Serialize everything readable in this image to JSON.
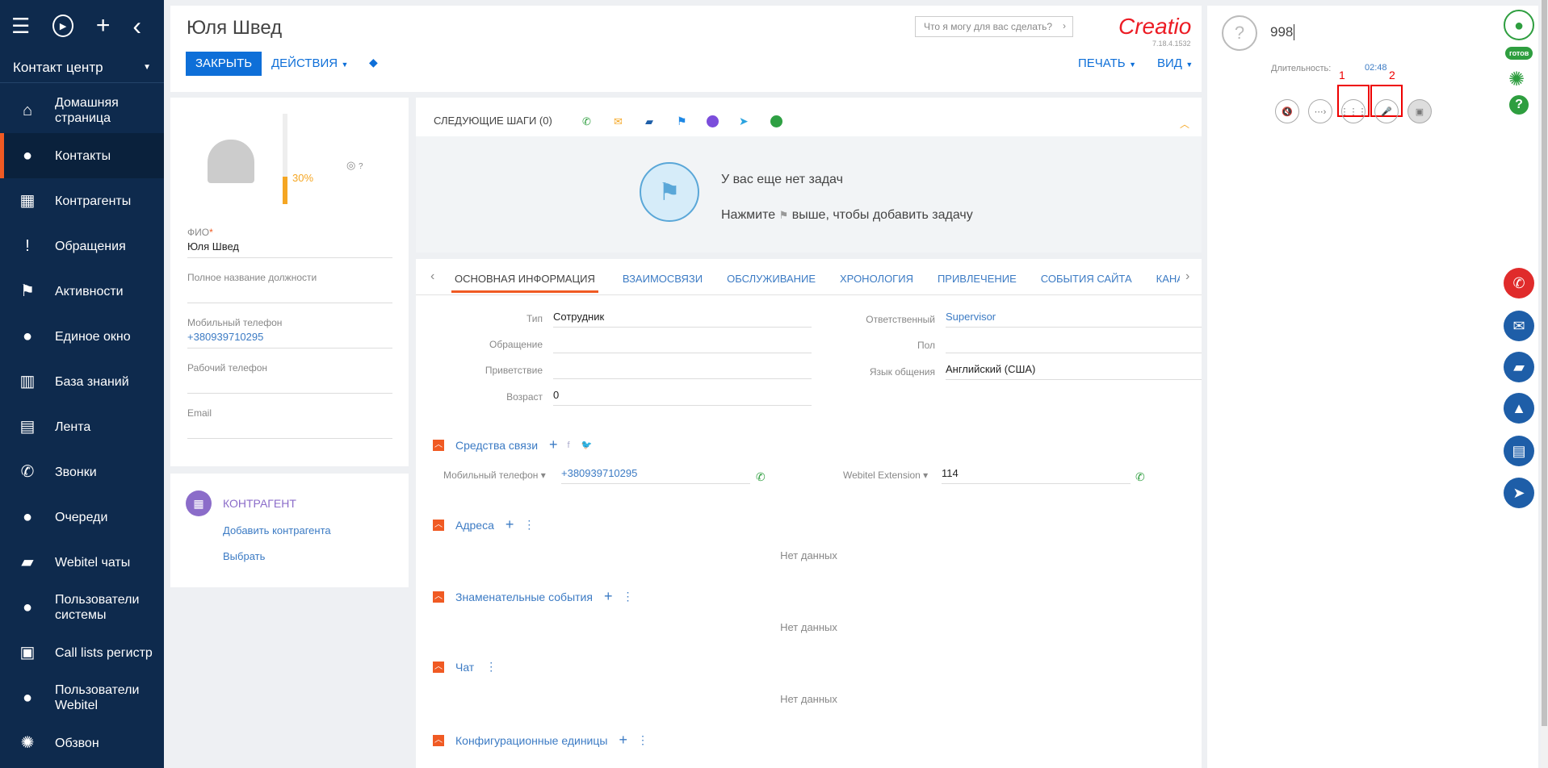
{
  "topbar": {
    "menu": "☰",
    "play": "▶",
    "add": "+",
    "back": "‹"
  },
  "workspace": "Контакт центр",
  "nav": [
    {
      "label": "Домашняя страница",
      "icon": "home-icon",
      "glyph": "⌂"
    },
    {
      "label": "Контакты",
      "icon": "person-icon",
      "glyph": "●"
    },
    {
      "label": "Контрагенты",
      "icon": "building-icon",
      "glyph": "▦"
    },
    {
      "label": "Обращения",
      "icon": "case-icon",
      "glyph": "!"
    },
    {
      "label": "Активности",
      "icon": "flag-icon",
      "glyph": "⚑"
    },
    {
      "label": "Единое окно",
      "icon": "agent-icon",
      "glyph": "●"
    },
    {
      "label": "База знаний",
      "icon": "book-icon",
      "glyph": "▥"
    },
    {
      "label": "Лента",
      "icon": "feed-icon",
      "glyph": "▤"
    },
    {
      "label": "Звонки",
      "icon": "phone-icon",
      "glyph": "✆"
    },
    {
      "label": "Очереди",
      "icon": "queue-icon",
      "glyph": "●"
    },
    {
      "label": "Webitel чаты",
      "icon": "chat-icon",
      "glyph": "▰"
    },
    {
      "label": "Пользователи системы",
      "icon": "user-lock-icon",
      "glyph": "●"
    },
    {
      "label": "Call lists регистр",
      "icon": "list-phone-icon",
      "glyph": "▣"
    },
    {
      "label": "Пользователи Webitel",
      "icon": "users-icon",
      "glyph": "●"
    },
    {
      "label": "Обзвон",
      "icon": "gear-phone-icon",
      "glyph": "✺"
    }
  ],
  "header": {
    "title": "Юля Швед",
    "close": "ЗАКРЫТЬ",
    "actions": "ДЕЙСТВИЯ",
    "print": "ПЕЧАТЬ",
    "view": "ВИД",
    "search_placeholder": "Что я могу для вас сделать?",
    "logo": "Creatio",
    "version": "7.18.4.1532"
  },
  "profile": {
    "completeness": "30%",
    "question": "?",
    "fio_label": "ФИО",
    "fio": "Юля Швед",
    "job_label": "Полное название должности",
    "mobile_label": "Мобильный телефон",
    "mobile": "+380939710295",
    "work_label": "Рабочий телефон",
    "email_label": "Email"
  },
  "account": {
    "title": "КОНТРАГЕНТ",
    "add": "Добавить контрагента",
    "select": "Выбрать"
  },
  "next_steps": {
    "title": "СЛЕДУЮЩИЕ ШАГИ (0)",
    "empty1": "У вас еще нет задач",
    "empty2a": "Нажмите",
    "empty2b": "выше, чтобы добавить задачу"
  },
  "tabs": [
    "ОСНОВНАЯ ИНФОРМАЦИЯ",
    "ВЗАИМОСВЯЗИ",
    "ОБСЛУЖИВАНИЕ",
    "ХРОНОЛОГИЯ",
    "ПРИВЛЕЧЕНИЕ",
    "СОБЫТИЯ САЙТА",
    "КАНАЛ"
  ],
  "fields": {
    "type_label": "Тип",
    "type": "Сотрудник",
    "appeal_label": "Обращение",
    "greeting_label": "Приветствие",
    "age_label": "Возраст",
    "age": "0",
    "owner_label": "Ответственный",
    "owner": "Supervisor",
    "gender_label": "Пол",
    "lang_label": "Язык общения",
    "lang": "Английский (США)"
  },
  "sections": {
    "comm": "Средства связи",
    "comm_mobile_label": "Мобильный телефон",
    "comm_mobile": "+380939710295",
    "ext_label": "Webitel Extension",
    "ext": "114",
    "addresses": "Адреса",
    "events": "Знаменательные события",
    "chat": "Чат",
    "config": "Конфигурационные единицы",
    "nodata": "Нет данных"
  },
  "phone": {
    "number": "998",
    "duration_label": "Длительность:",
    "duration": "02:48",
    "marker1": "1",
    "marker2": "2",
    "status": "готов"
  }
}
